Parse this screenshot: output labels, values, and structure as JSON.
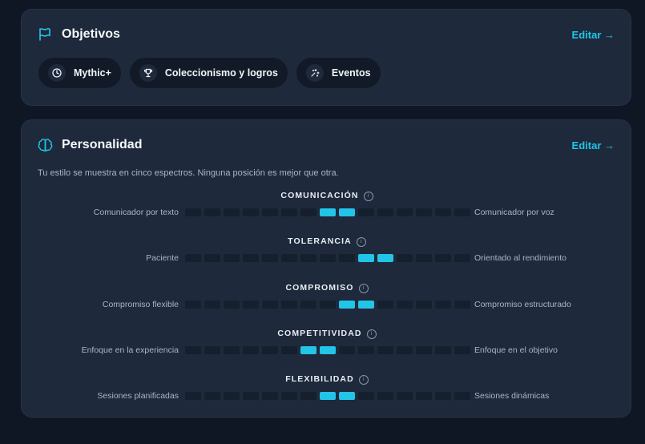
{
  "objetivos": {
    "title": "Objetivos",
    "edit_label": "Editar →",
    "pills": [
      {
        "label": "Mythic+",
        "icon": "clock-icon"
      },
      {
        "label": "Coleccionismo y logros",
        "icon": "trophy-icon"
      },
      {
        "label": "Eventos",
        "icon": "sparkles-icon"
      }
    ]
  },
  "personalidad": {
    "title": "Personalidad",
    "edit_label": "Editar →",
    "description": "Tu estilo se muestra en cinco espectros. Ninguna posición es mejor que otra.",
    "segments_total": 15,
    "spectra": [
      {
        "title": "COMUNICACIÓN",
        "left": "Comunicador por texto",
        "right": "Comunicador por voz",
        "active": [
          7,
          8
        ]
      },
      {
        "title": "TOLERANCIA",
        "left": "Paciente",
        "right": "Orientado al rendimiento",
        "active": [
          9,
          10
        ]
      },
      {
        "title": "COMPROMISO",
        "left": "Compromiso flexible",
        "right": "Compromiso estructurado",
        "active": [
          8,
          9
        ]
      },
      {
        "title": "COMPETITIVIDAD",
        "left": "Enfoque en la experiencia",
        "right": "Enfoque en el objetivo",
        "active": [
          6,
          7
        ]
      },
      {
        "title": "FLEXIBILIDAD",
        "left": "Sesiones planificadas",
        "right": "Sesiones dinámicas",
        "active": [
          7,
          8
        ]
      }
    ]
  },
  "colors": {
    "accent": "#22c5e8",
    "card": "#1e293b",
    "background": "#0f1724"
  }
}
